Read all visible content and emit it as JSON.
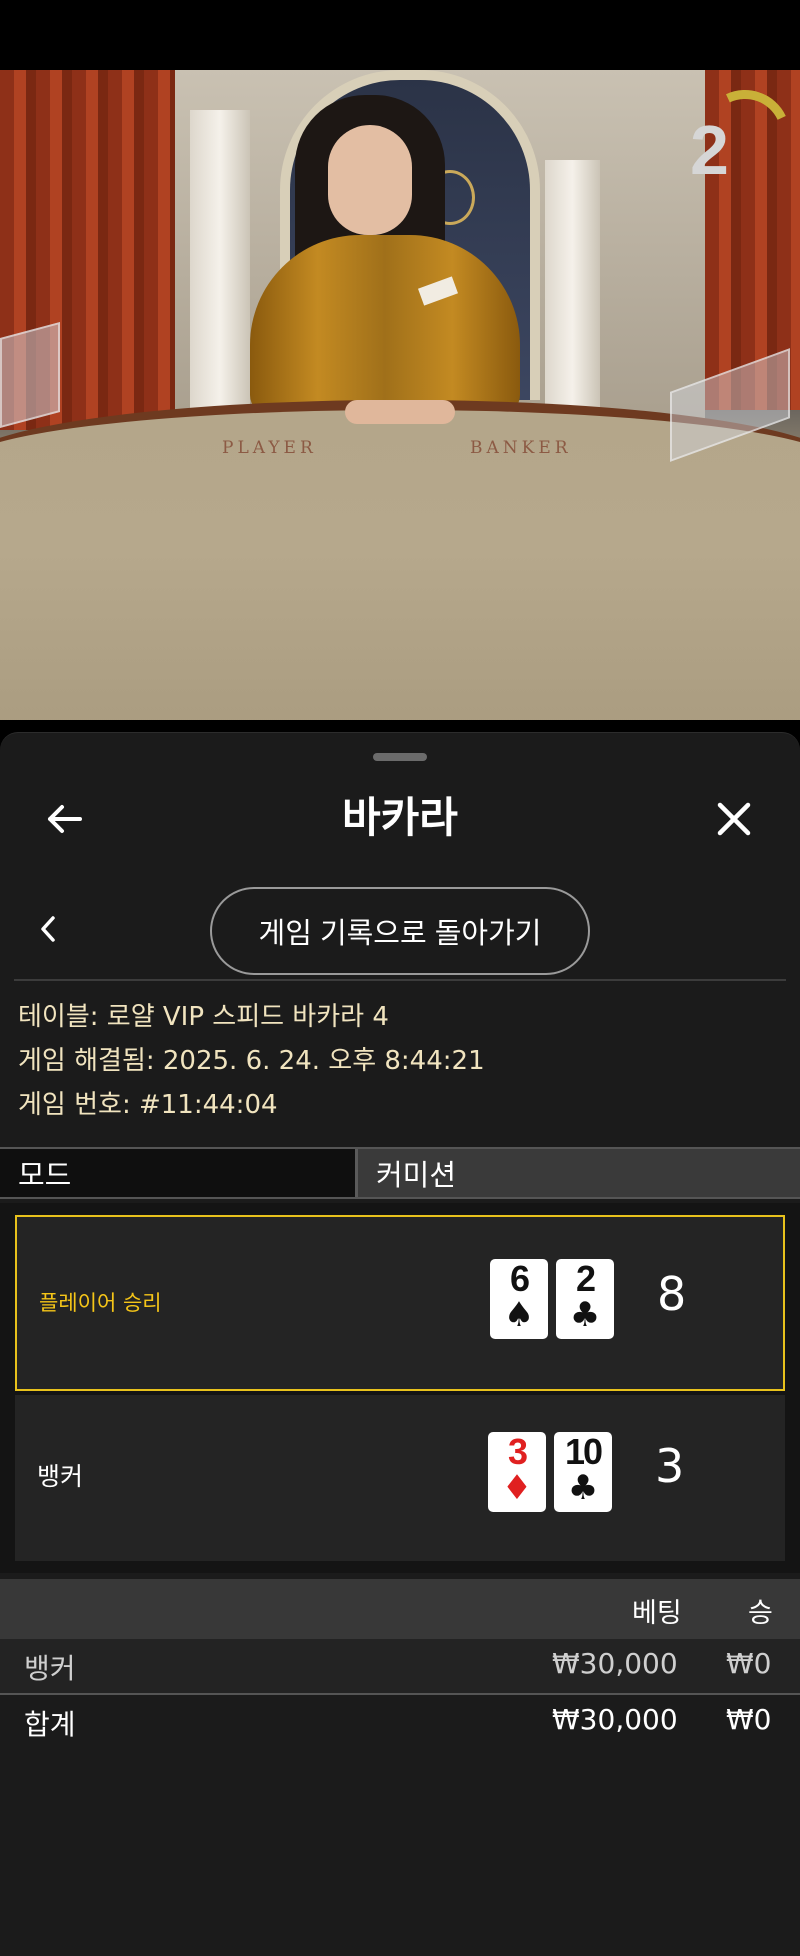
{
  "video": {
    "timer_value": "2",
    "table_labels": [
      "PLAYER",
      "BANKER"
    ]
  },
  "sheet": {
    "title": "바카라",
    "back_icon": "arrow-left-icon",
    "close_icon": "close-icon",
    "history_button": "게임 기록으로 돌아가기",
    "info": {
      "table": "테이블: 로얄 VIP 스피드 바카라 4",
      "resolved": "게임 해결됨: 2025. 6. 24. 오후 8:44:21",
      "game_number": "게임 번호: #11:44:04"
    },
    "tabs": {
      "mode": "모드",
      "commission": "커미션"
    },
    "results": [
      {
        "label": "플레이어 승리",
        "winner": true,
        "score": "8",
        "cards": [
          {
            "rank": "6",
            "suit": "♠",
            "color": "black"
          },
          {
            "rank": "2",
            "suit": "♣",
            "color": "black"
          }
        ]
      },
      {
        "label": "뱅커",
        "winner": false,
        "score": "3",
        "cards": [
          {
            "rank": "3",
            "suit": "♦",
            "color": "red"
          },
          {
            "rank": "10",
            "suit": "♣",
            "color": "black"
          }
        ]
      }
    ],
    "bets": {
      "headers": {
        "bet": "베팅",
        "win": "승"
      },
      "rows": [
        {
          "name": "뱅커",
          "bet": "₩30,000",
          "win": "₩0"
        }
      ],
      "total": {
        "name": "합계",
        "bet": "₩30,000",
        "win": "₩0"
      }
    }
  },
  "colors": {
    "accent_gold": "#e8c21c",
    "win_label": "#f5c518",
    "info_text": "#f1e4bf"
  }
}
